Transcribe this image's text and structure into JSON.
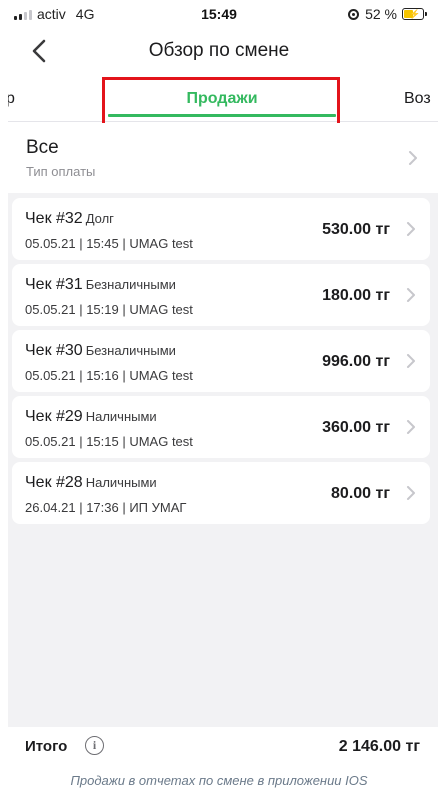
{
  "status_bar": {
    "carrier": "activ",
    "network": "4G",
    "time": "15:49",
    "battery": "52 %",
    "battery_level": 0.52
  },
  "header": {
    "title": "Обзор по смене"
  },
  "tabs": {
    "prev_partial": "р",
    "active": "Продажи",
    "next_partial": "Воз"
  },
  "filter": {
    "value": "Все",
    "label": "Тип оплаты"
  },
  "receipts": [
    {
      "title": "Чек #32",
      "type": "Долг",
      "meta": "05.05.21 | 15:45 | UMAG test",
      "amount": "530.00 тг"
    },
    {
      "title": "Чек #31",
      "type": "Безналичными",
      "meta": "05.05.21 | 15:19 | UMAG test",
      "amount": "180.00 тг"
    },
    {
      "title": "Чек #30",
      "type": "Безналичными",
      "meta": "05.05.21 | 15:16 | UMAG test",
      "amount": "996.00 тг"
    },
    {
      "title": "Чек #29",
      "type": "Наличными",
      "meta": "05.05.21 | 15:15 | UMAG test",
      "amount": "360.00 тг"
    },
    {
      "title": "Чек #28",
      "type": "Наличными",
      "meta": "26.04.21 | 17:36 | ИП УМАГ",
      "amount": "80.00 тг"
    }
  ],
  "footer": {
    "total_label": "Итого",
    "total_amount": "2 146.00 тг"
  },
  "caption": "Продажи в отчетах по смене в приложении IOS",
  "colors": {
    "accent_green": "#34b95f",
    "highlight_red": "#e3141b",
    "battery_yellow": "#f5c400"
  }
}
